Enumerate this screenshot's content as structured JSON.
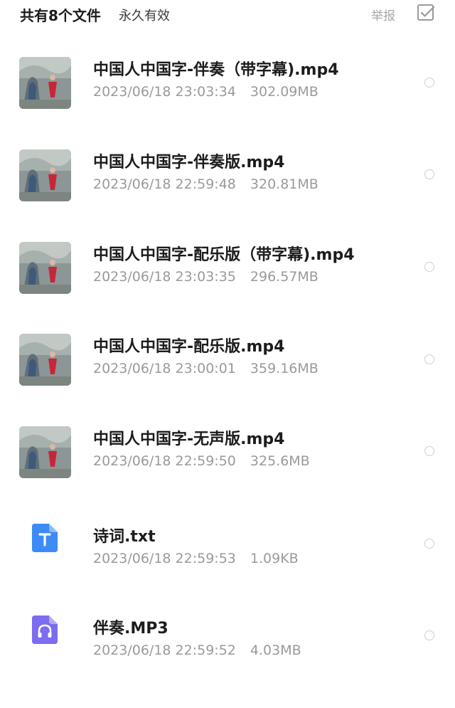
{
  "header": {
    "count_label": "共有8个文件",
    "validity_label": "永久有效",
    "report_label": "举报",
    "select_all_icon": "checkbox-icon"
  },
  "files": [
    {
      "name": "中国人中国字-伴奏（带字幕).mp4",
      "date": "2023/06/18 23:03:34",
      "size": "302.09MB",
      "type": "video"
    },
    {
      "name": "中国人中国字-伴奏版.mp4",
      "date": "2023/06/18 22:59:48",
      "size": "320.81MB",
      "type": "video"
    },
    {
      "name": "中国人中国字-配乐版（带字幕).mp4",
      "date": "2023/06/18 23:03:35",
      "size": "296.57MB",
      "type": "video"
    },
    {
      "name": "中国人中国字-配乐版.mp4",
      "date": "2023/06/18 23:00:01",
      "size": "359.16MB",
      "type": "video"
    },
    {
      "name": "中国人中国字-无声版.mp4",
      "date": "2023/06/18 22:59:50",
      "size": "325.6MB",
      "type": "video"
    },
    {
      "name": "诗词.txt",
      "date": "2023/06/18 22:59:53",
      "size": "1.09KB",
      "type": "text"
    },
    {
      "name": "伴奏.MP3",
      "date": "2023/06/18 22:59:52",
      "size": "4.03MB",
      "type": "audio"
    }
  ],
  "colors": {
    "text_icon": "#3d8bf5",
    "audio_icon": "#7b6cf0",
    "muted": "#9a9a9a"
  }
}
